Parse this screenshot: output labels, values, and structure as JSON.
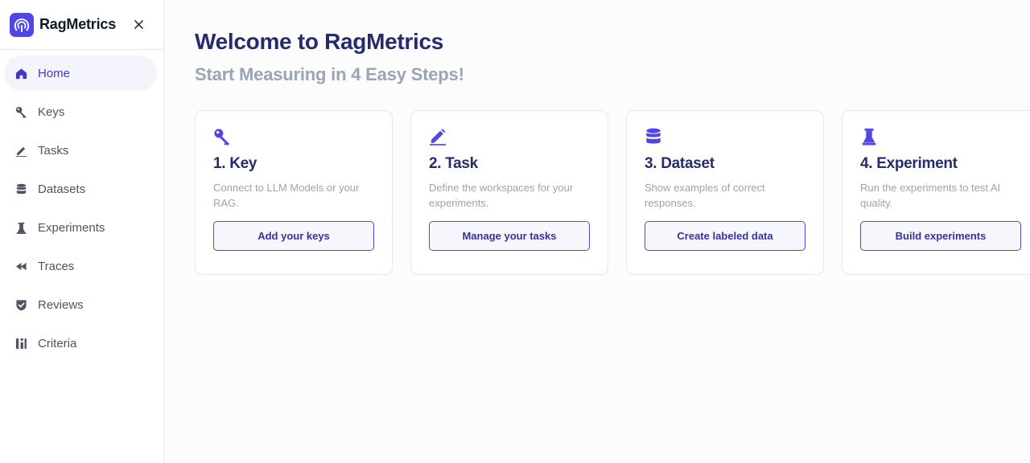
{
  "brand": {
    "name": "RagMetrics",
    "logo_icon": "radar-logo-icon",
    "close_icon": "close-icon"
  },
  "colors": {
    "accent": "#4f46e5",
    "title": "#262c6b",
    "subtitle": "#9aa3b8",
    "active_bg": "#f3f4fc"
  },
  "sidebar": {
    "items": [
      {
        "label": "Home",
        "icon": "home-icon",
        "active": true
      },
      {
        "label": "Keys",
        "icon": "key-icon",
        "active": false
      },
      {
        "label": "Tasks",
        "icon": "pencil-icon",
        "active": false
      },
      {
        "label": "Datasets",
        "icon": "database-icon",
        "active": false
      },
      {
        "label": "Experiments",
        "icon": "flask-icon",
        "active": false
      },
      {
        "label": "Traces",
        "icon": "rewind-icon",
        "active": false
      },
      {
        "label": "Reviews",
        "icon": "shield-check-icon",
        "active": false
      },
      {
        "label": "Criteria",
        "icon": "criteria-icon",
        "active": false
      }
    ]
  },
  "main": {
    "title": "Welcome to RagMetrics",
    "subtitle": "Start Measuring in 4 Easy Steps!",
    "cards": [
      {
        "icon": "key-icon",
        "title": "1. Key",
        "description": "Connect to LLM Models or your RAG.",
        "button": "Add your keys"
      },
      {
        "icon": "pencil-icon",
        "title": "2. Task",
        "description": "Define the workspaces for your experiments.",
        "button": "Manage your tasks"
      },
      {
        "icon": "database-icon",
        "title": "3. Dataset",
        "description": "Show examples of correct responses.",
        "button": "Create labeled data"
      },
      {
        "icon": "flask-icon",
        "title": "4. Experiment",
        "description": "Run the experiments to test AI quality.",
        "button": "Build experiments"
      }
    ]
  }
}
